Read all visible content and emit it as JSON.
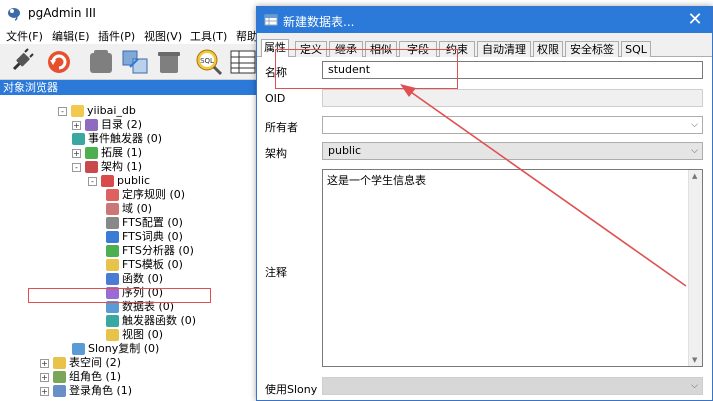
{
  "main_window": {
    "title": "pgAdmin III",
    "menus": [
      "文件(F)",
      "编辑(E)",
      "插件(P)",
      "视图(V)",
      "工具(T)",
      "帮助"
    ],
    "toolbar_sql_label": "SQL"
  },
  "browser": {
    "header": "对象浏览器",
    "tree": [
      {
        "label": "yiibai_db",
        "icon": "database-icon",
        "expander": "-"
      },
      {
        "label": "目录 (2)",
        "icon": "catalog-icon",
        "expander": "+"
      },
      {
        "label": "事件触发器 (0)",
        "icon": "event-trigger-icon",
        "expander": ""
      },
      {
        "label": "拓展 (1)",
        "icon": "extension-icon",
        "expander": "+"
      },
      {
        "label": "架构 (1)",
        "icon": "schema-icon",
        "expander": "-"
      },
      {
        "label": "public",
        "icon": "schema-public-icon",
        "expander": "-"
      },
      {
        "label": "定序规则 (0)",
        "icon": "collation-icon",
        "expander": ""
      },
      {
        "label": "域 (0)",
        "icon": "domain-icon",
        "expander": ""
      },
      {
        "label": "FTS配置 (0)",
        "icon": "fts-config-icon",
        "expander": ""
      },
      {
        "label": "FTS词典 (0)",
        "icon": "fts-dictionary-icon",
        "expander": ""
      },
      {
        "label": "FTS分析器 (0)",
        "icon": "fts-parser-icon",
        "expander": ""
      },
      {
        "label": "FTS模板 (0)",
        "icon": "fts-template-icon",
        "expander": ""
      },
      {
        "label": "函数 (0)",
        "icon": "function-icon",
        "expander": ""
      },
      {
        "label": "序列 (0)",
        "icon": "sequence-icon",
        "expander": ""
      },
      {
        "label": "数据表 (0)",
        "icon": "table-icon",
        "expander": ""
      },
      {
        "label": "触发器函数 (0)",
        "icon": "trigger-function-icon",
        "expander": ""
      },
      {
        "label": "视图 (0)",
        "icon": "view-icon",
        "expander": ""
      },
      {
        "label": "Slony复制 (0)",
        "icon": "slony-icon",
        "expander": ""
      },
      {
        "label": "表空间 (2)",
        "icon": "tablespace-icon",
        "expander": "+"
      },
      {
        "label": "组角色 (1)",
        "icon": "group-role-icon",
        "expander": "+"
      },
      {
        "label": "登录角色 (1)",
        "icon": "login-role-icon",
        "expander": "+"
      }
    ]
  },
  "dialog": {
    "title": "新建数据表...",
    "close_glyph": "✕",
    "tabs": [
      "属性",
      "定义",
      "继承",
      "相似",
      "字段",
      "约束",
      "自动清理",
      "权限",
      "安全标签",
      "SQL"
    ],
    "active_tab": "属性",
    "fields": {
      "name_label": "名称",
      "name_value": "student",
      "oid_label": "OID",
      "oid_value": "",
      "owner_label": "所有者",
      "owner_value": "",
      "schema_label": "架构",
      "schema_value": "public",
      "comment_label": "注释",
      "comment_value": "这是一个学生信息表",
      "slony_label": "使用Slony",
      "slony_value": ""
    },
    "dropdown_glyph": "⌵",
    "scroll_up_glyph": "▲",
    "scroll_down_glyph": "▼"
  },
  "colors": {
    "titlebar_active": "#2b79d8",
    "annotation": "#e05050"
  }
}
